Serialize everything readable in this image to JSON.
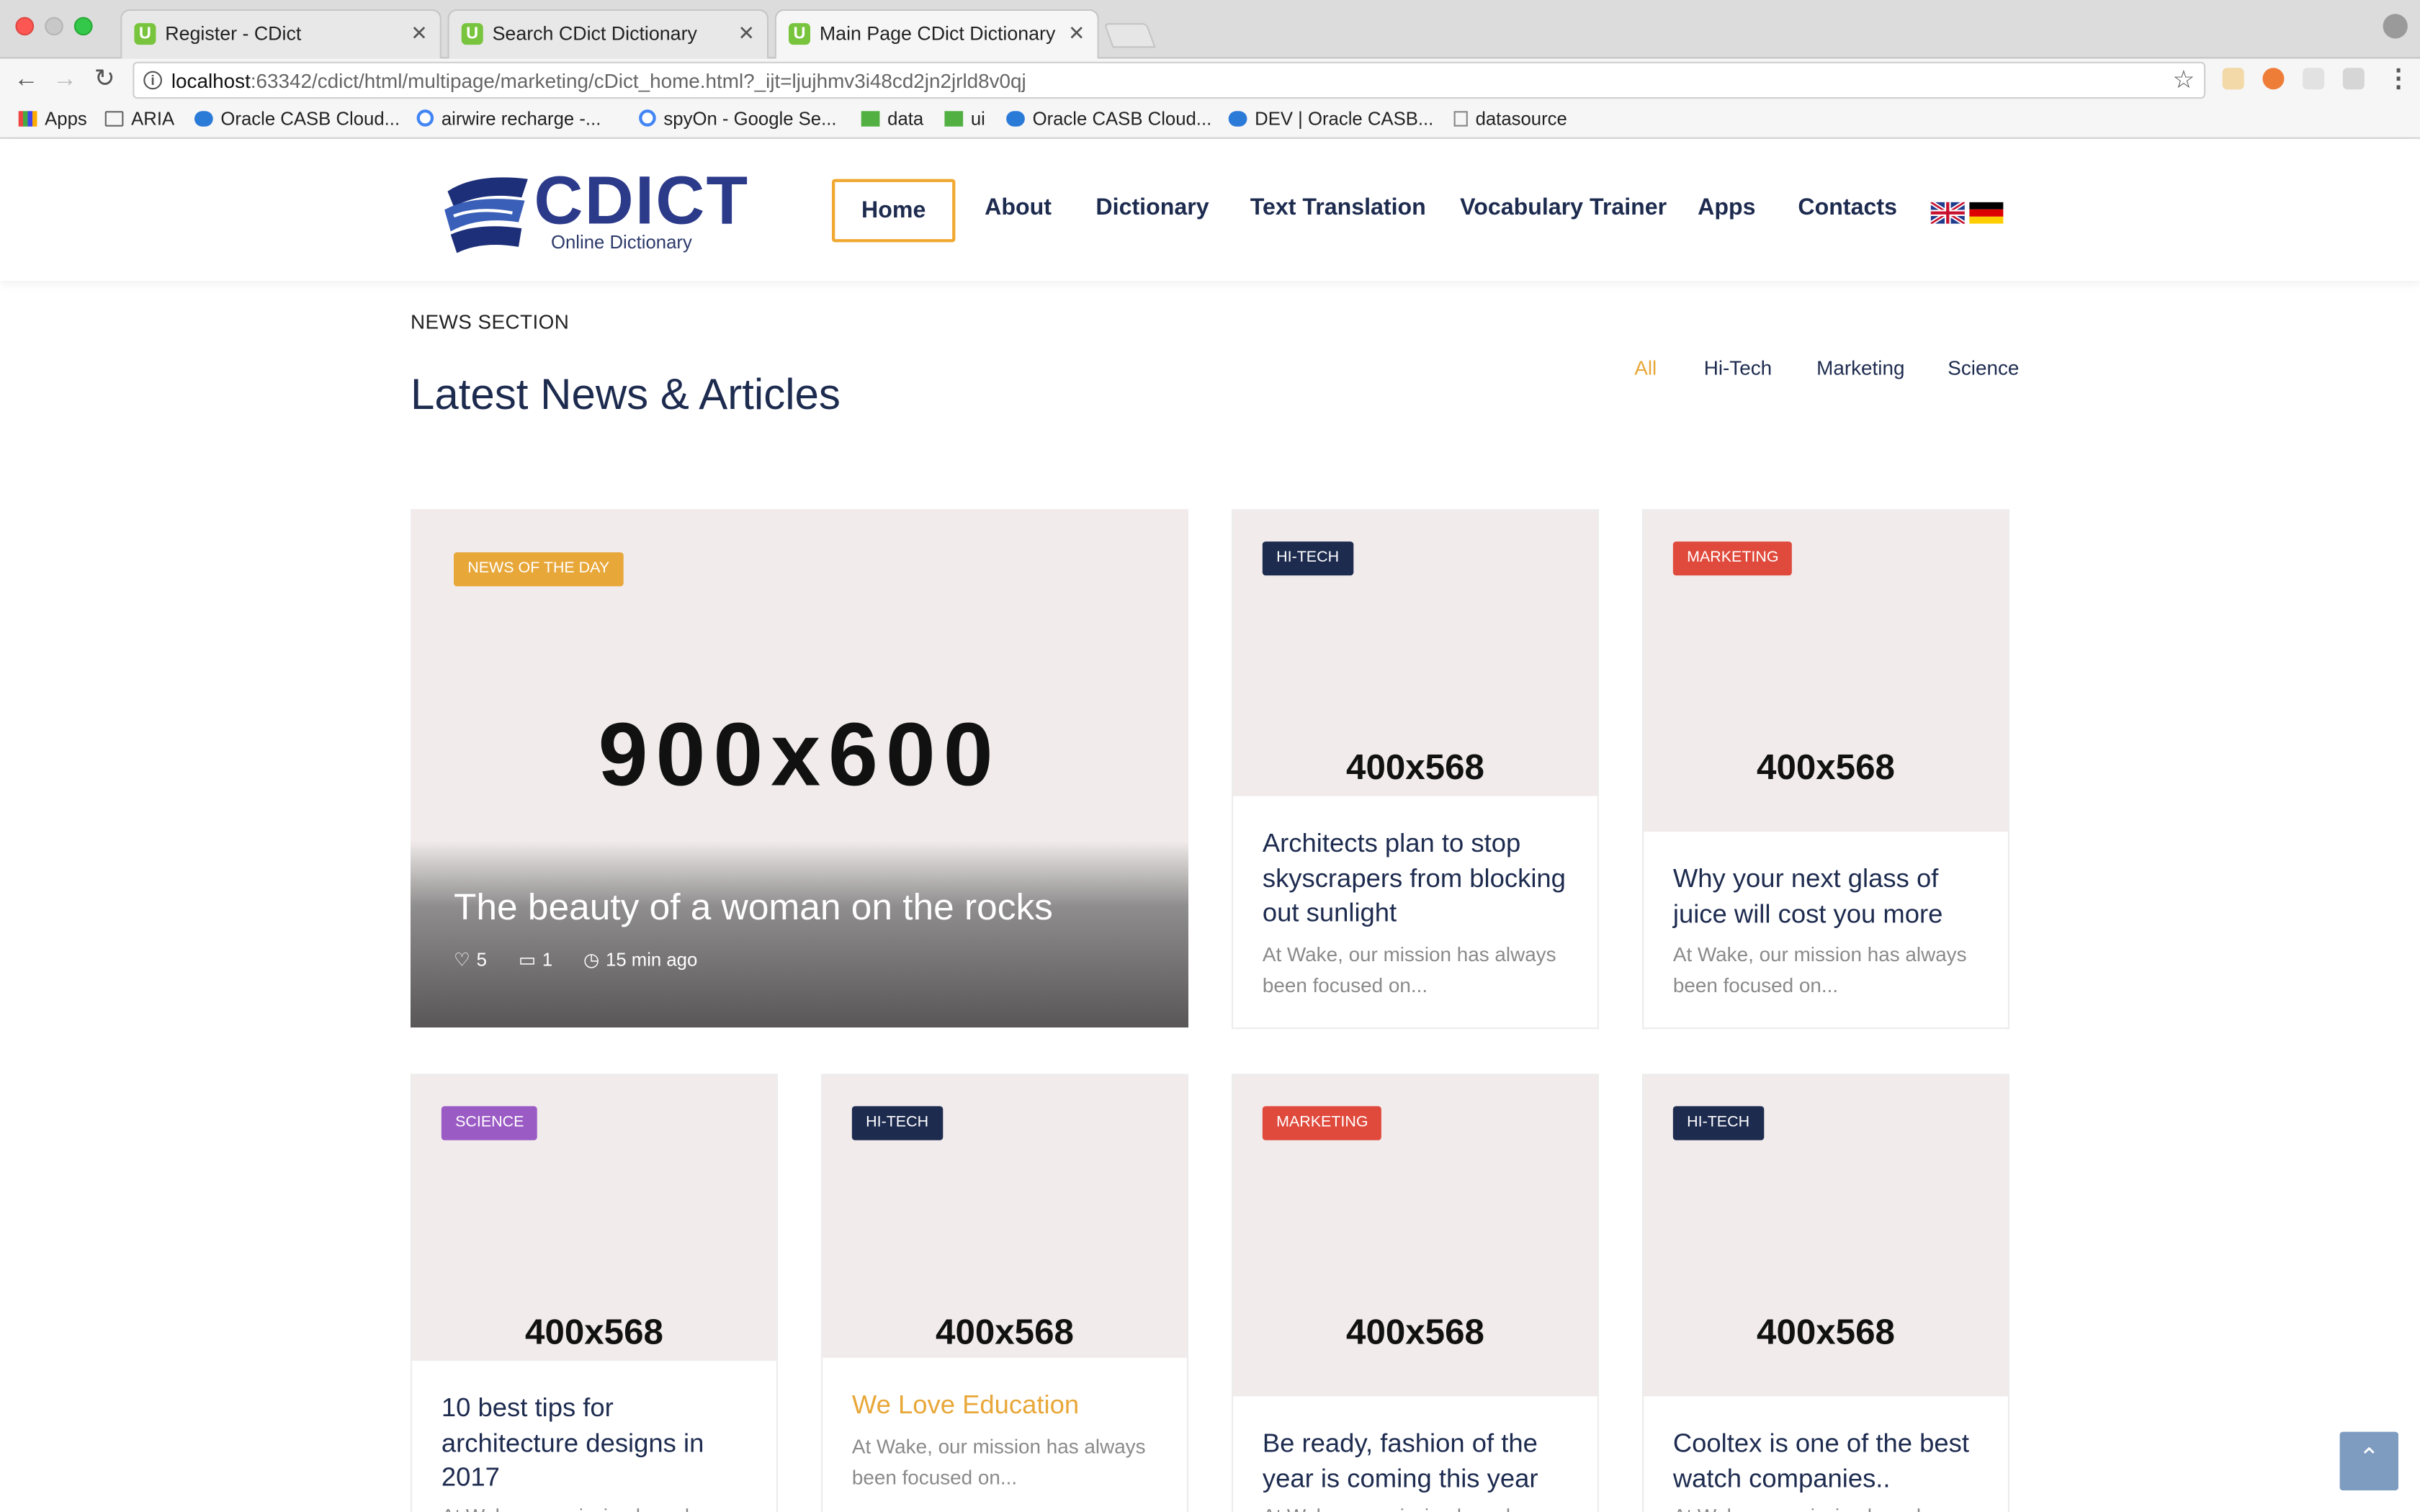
{
  "browser": {
    "tabs": [
      {
        "title": "Register - CDict",
        "favicon": "U"
      },
      {
        "title": "Search CDict Dictionary",
        "favicon": "U"
      },
      {
        "title": "Main Page CDict Dictionary",
        "favicon": "U"
      }
    ],
    "url_host": "localhost",
    "url_rest": ":63342/cdict/html/multipage/marketing/cDict_home.html?_ijt=ljujhmv3i48cd2jn2jrld8v0qj",
    "bookmarks": [
      "Apps",
      "ARIA",
      "Oracle CASB Cloud...",
      "airwire recharge -...",
      "spyOn - Google Se...",
      "data",
      "ui",
      "Oracle CASB Cloud...",
      "DEV | Oracle CASB...",
      "datasource"
    ]
  },
  "site": {
    "logo_text": "CDICT",
    "logo_sub": "Online Dictionary",
    "menu": [
      "Home",
      "About",
      "Dictionary",
      "Text Translation",
      "Vocabulary Trainer",
      "Apps",
      "Contacts"
    ],
    "languages": [
      "English",
      "German"
    ]
  },
  "news": {
    "section_label": "NEWS SECTION",
    "title": "Latest News & Articles",
    "filters": [
      "All",
      "Hi-Tech",
      "Marketing",
      "Science"
    ],
    "featured": {
      "badge": "NEWS OF THE DAY",
      "image_label": "900x600",
      "title": "The beauty of a woman on the rocks",
      "likes": "5",
      "comments": "1",
      "time": "15 min ago"
    },
    "cards": [
      {
        "badge": "HI-TECH",
        "image_label": "400x568",
        "title": "Architects plan to stop skyscrapers from blocking out sunlight",
        "excerpt": "At Wake, our mission has always been focused on..."
      },
      {
        "badge": "MARKETING",
        "image_label": "400x568",
        "title": "Why your next glass of juice will cost you more",
        "excerpt": "At Wake, our mission has always been focused on..."
      },
      {
        "badge": "SCIENCE",
        "image_label": "400x568",
        "title": "10 best tips for architecture designs in 2017",
        "excerpt": "At Wake, our mission has always been focused on..."
      },
      {
        "badge": "HI-TECH",
        "image_label": "400x568",
        "title": "We Love Education",
        "excerpt": "At Wake, our mission has always been focused on..."
      },
      {
        "badge": "MARKETING",
        "image_label": "400x568",
        "title": "Be ready, fashion of the year is coming this year",
        "excerpt": "At Wake, our mission has always been focused on..."
      },
      {
        "badge": "HI-TECH",
        "image_label": "400x568",
        "title": "Cooltex is one of the best watch companies..",
        "excerpt": "At Wake, our mission has always been focused on..."
      }
    ]
  },
  "colors": {
    "navy": "#1d2b4f",
    "accent": "#e8a739",
    "hitech": "#1d2b4f",
    "marketing": "#e04a3c",
    "science": "#9b5bc5",
    "news_of_day": "#e8a739"
  },
  "icons": [
    "back-arrow-icon",
    "forward-arrow-icon",
    "reload-icon",
    "info-icon",
    "star-icon",
    "heart-icon",
    "comment-icon",
    "clock-icon",
    "arrow-up-icon"
  ]
}
